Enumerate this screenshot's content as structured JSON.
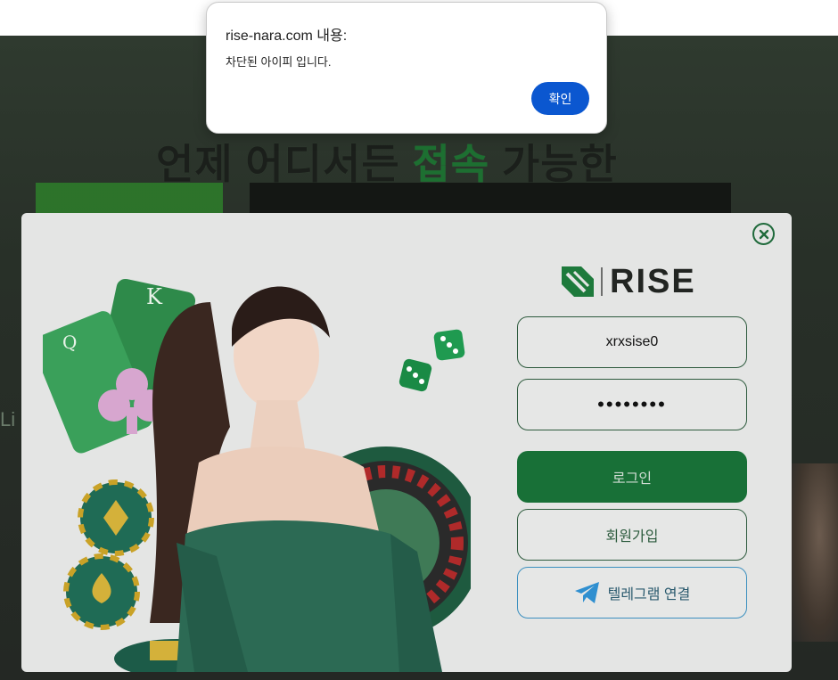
{
  "alert": {
    "title": "rise-nara.com 내용:",
    "message": "차단된 아이피 입니다.",
    "ok_label": "확인",
    "button_color": "#0b57d0"
  },
  "background": {
    "headline_part1": "언제 어디서든 ",
    "headline_accent": "접속",
    "headline_part2": " 가능한",
    "side_text": "Li"
  },
  "login_modal": {
    "close_icon": "close-circle-icon",
    "logo_text": "RISE",
    "username_value": "xrxsise0",
    "password_value": "••••••••",
    "login_label": "로그인",
    "join_label": "회원가입",
    "telegram_label": "텔레그램 연결",
    "telegram_icon": "telegram-plane-icon",
    "brand_green": "#187037",
    "telegram_blue": "#3b8fbf"
  }
}
